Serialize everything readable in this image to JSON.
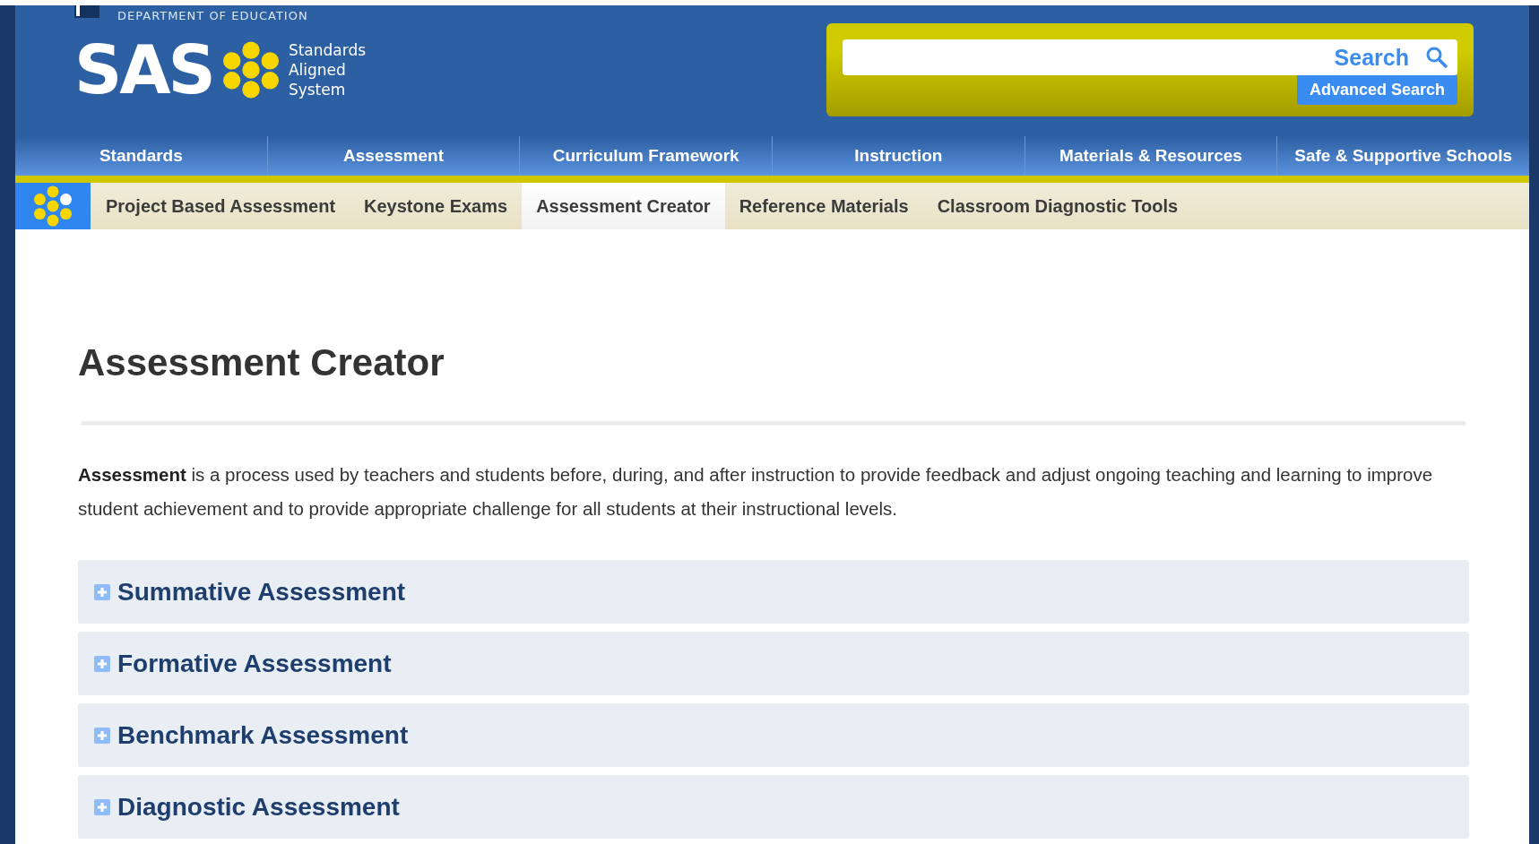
{
  "header": {
    "department": "DEPARTMENT OF EDUCATION",
    "logo_text": "SAS",
    "logo_subtitle": [
      "Standards",
      "Aligned",
      "System"
    ]
  },
  "search": {
    "button": "Search",
    "advanced": "Advanced Search"
  },
  "main_nav": [
    {
      "label": "Standards",
      "selected": false
    },
    {
      "label": "Assessment",
      "selected": false
    },
    {
      "label": "Curriculum Framework",
      "selected": false
    },
    {
      "label": "Instruction",
      "selected": false
    },
    {
      "label": "Materials & Resources",
      "selected": false
    },
    {
      "label": "Safe & Supportive Schools",
      "selected": false
    }
  ],
  "sub_nav": [
    {
      "label": "Project Based Assessment",
      "selected": false
    },
    {
      "label": "Keystone Exams",
      "selected": false
    },
    {
      "label": "Assessment Creator",
      "selected": true
    },
    {
      "label": "Reference Materials",
      "selected": false
    },
    {
      "label": "Classroom Diagnostic Tools",
      "selected": false
    }
  ],
  "title": "Assessment Creator",
  "intro": "**Assessment** is a process used by teachers and students before, during, and after instruction to provide feedback and adjust ongoing teaching and learning to improve student achievement and to provide appropriate challenge for all students at their instructional levels.",
  "sections": [
    {
      "title": "Summative Assessment",
      "expanded": false
    },
    {
      "title": "Formative Assessment",
      "expanded": false
    },
    {
      "title": "Benchmark Assessment",
      "expanded": false
    },
    {
      "title": "Diagnostic Assessment",
      "expanded": false
    }
  ]
}
